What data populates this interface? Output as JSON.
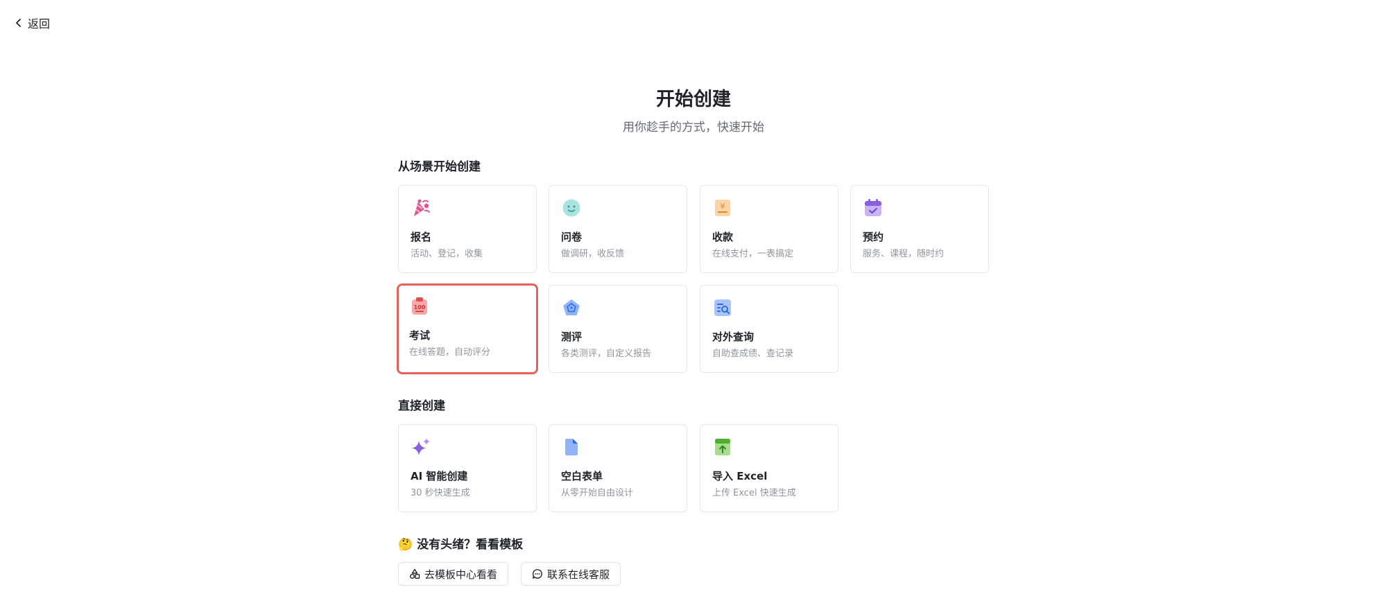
{
  "nav": {
    "back_label": "返回"
  },
  "header": {
    "title": "开始创建",
    "subtitle": "用你趁手的方式，快速开始"
  },
  "scenario_section": {
    "title": "从场景开始创建",
    "cards": [
      {
        "title": "报名",
        "desc": "活动、登记，收集",
        "icon": "party-popper-icon"
      },
      {
        "title": "问卷",
        "desc": "做调研，收反馈",
        "icon": "smiley-icon"
      },
      {
        "title": "收款",
        "desc": "在线支付，一表搞定",
        "icon": "yuan-receipt-icon"
      },
      {
        "title": "预约",
        "desc": "服务、课程，随时约",
        "icon": "calendar-check-icon"
      },
      {
        "title": "考试",
        "desc": "在线答题，自动评分",
        "icon": "exam-score-icon",
        "selected": true
      },
      {
        "title": "测评",
        "desc": "各类测评，自定义报告",
        "icon": "pentagon-rating-icon"
      },
      {
        "title": "对外查询",
        "desc": "自助查成绩、查记录",
        "icon": "list-search-icon"
      }
    ]
  },
  "direct_section": {
    "title": "直接创建",
    "cards": [
      {
        "title": "AI 智能创建",
        "desc": "30 秒快速生成",
        "icon": "sparkle-icon"
      },
      {
        "title": "空白表单",
        "desc": "从零开始自由设计",
        "icon": "blank-document-icon"
      },
      {
        "title": "导入 Excel",
        "desc": "上传 Excel 快速生成",
        "icon": "upload-excel-icon"
      }
    ]
  },
  "template_section": {
    "emoji": "🤔",
    "title": "没有头绪？看看模板",
    "buttons": [
      {
        "label": "去模板中心看看",
        "icon": "shapes-icon"
      },
      {
        "label": "联系在线客服",
        "icon": "chat-bubble-icon"
      }
    ]
  },
  "colors": {
    "selected_border": "#e5625c",
    "card_border": "#e5e6eb",
    "muted_text": "#8f959e"
  }
}
